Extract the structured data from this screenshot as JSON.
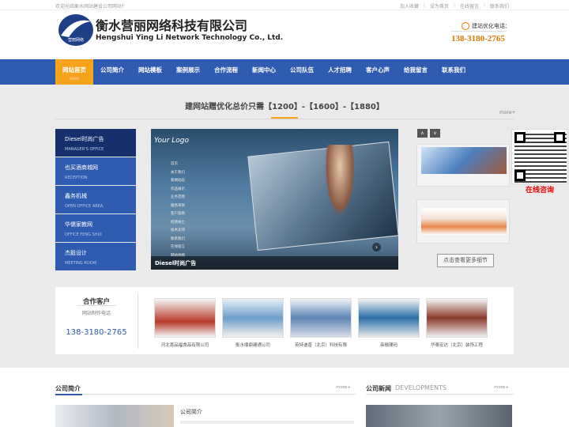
{
  "topbar": {
    "welcome": "欢迎光临衡水网站建设公司网站！",
    "links": [
      "加入收藏",
      "设为首页",
      "在线留言",
      "联系我们"
    ]
  },
  "header": {
    "company_cn": "衡水营丽网络科技有限公司",
    "company_en": "Hengshui Ying Li Network Technology Co., Ltd.",
    "hotline_label": "建站优化电话：",
    "hotline_phone": "138-3180-2765"
  },
  "nav": {
    "items": [
      {
        "label": "网站首页",
        "sub": "HOME",
        "active": true
      },
      {
        "label": "公司简介"
      },
      {
        "label": "网站模板"
      },
      {
        "label": "案例展示"
      },
      {
        "label": "合作流程"
      },
      {
        "label": "新闻中心"
      },
      {
        "label": "公司队伍"
      },
      {
        "label": "人才招聘"
      },
      {
        "label": "客户心声"
      },
      {
        "label": "给我留言"
      },
      {
        "label": "联系我们"
      }
    ]
  },
  "banner": {
    "slogan": "建网站赠优化总价只需【1200】-【1600】-【1880】",
    "more": "more+"
  },
  "leftmenu": [
    {
      "title": "Diesel时尚广告",
      "sub": "MANAGER'S OFFICE"
    },
    {
      "title": "也买酒商城网",
      "sub": "RECEPTION"
    },
    {
      "title": "鑫务机械",
      "sub": "OPEN OFFICE AREA"
    },
    {
      "title": "华儒家教网",
      "sub": "OFFICE FENG SHUI"
    },
    {
      "title": "杰毅设计",
      "sub": "MEETING ROOM"
    }
  ],
  "feature": {
    "logo_text": "Your Logo",
    "caption": "Diesel时尚广告",
    "menu_lines": [
      "首页",
      "关于我们",
      "新闻动态",
      "作品展示",
      "业务范围",
      "服务项目",
      "客户案例",
      "招贤纳士",
      "技术支持",
      "联系我们",
      "在线留言",
      "网站地图"
    ]
  },
  "rpanel": {
    "prev": "∧",
    "next": "∨",
    "more_button": "点击查看更多细节",
    "qr_label": "在线咨询"
  },
  "partners": {
    "title": "合作客户",
    "subtitle": "网站制作电话",
    "phone": "138-3180-2765",
    "items": [
      {
        "caption": "河北喜品福食品有限公司"
      },
      {
        "caption": "衡水顺鼎建通公司"
      },
      {
        "caption": "英特迪普（北京）科技有限"
      },
      {
        "caption": "串融珊码"
      },
      {
        "caption": "华泰宏达（北京）装饰工程"
      }
    ]
  },
  "bottom": {
    "left_title": "公司简介",
    "left_more": "more+",
    "left_heading": "公司简介",
    "right_title": "公司新闻",
    "right_en": "DEVELOPMENTS",
    "right_more": "more+"
  }
}
